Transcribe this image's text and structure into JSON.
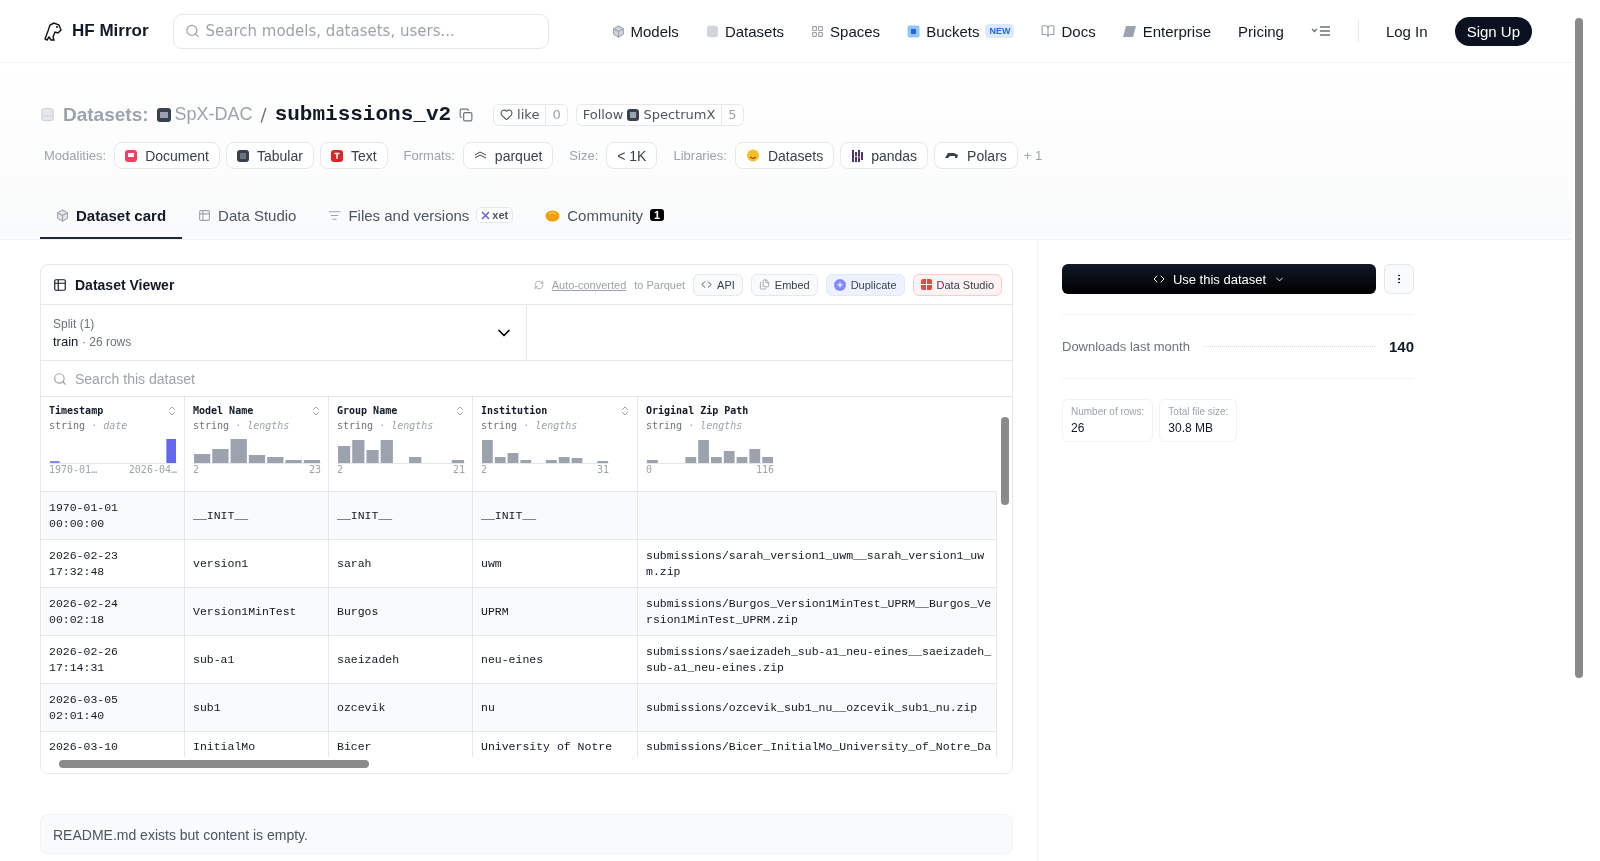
{
  "header": {
    "brand": "HF Mirror",
    "search": {
      "placeholder": "Search models, datasets, users..."
    },
    "nav": [
      {
        "label": "Models",
        "kind": "models"
      },
      {
        "label": "Datasets",
        "kind": "datasets"
      },
      {
        "label": "Spaces",
        "kind": "spaces"
      },
      {
        "label": "Buckets",
        "kind": "buckets",
        "badge": "NEW"
      },
      {
        "label": "Docs",
        "kind": "docs"
      },
      {
        "label": "Enterprise",
        "kind": "enterprise"
      },
      {
        "label": "Pricing",
        "kind": "plain"
      }
    ],
    "login": "Log In",
    "signup": "Sign Up"
  },
  "repo": {
    "type": "Datasets:",
    "owner": "SpX-DAC",
    "separator": "/",
    "name": "submissions_v2",
    "like": {
      "label": "like",
      "count": "0"
    },
    "follow": {
      "label": "Follow",
      "org": "SpectrumX",
      "count": "5"
    }
  },
  "tags": [
    {
      "label": "Modalities:",
      "items": [
        {
          "text": "Document",
          "kind": "document"
        },
        {
          "text": "Tabular",
          "kind": "tabular"
        },
        {
          "text": "Text",
          "kind": "text"
        }
      ]
    },
    {
      "label": "Formats:",
      "items": [
        {
          "text": "parquet",
          "kind": "parquet"
        }
      ]
    },
    {
      "label": "Size:",
      "items": [
        {
          "text": "< 1K",
          "kind": "plain"
        }
      ]
    },
    {
      "label": "Libraries:",
      "items": [
        {
          "text": "Datasets",
          "kind": "hf"
        },
        {
          "text": "pandas",
          "kind": "pandas"
        },
        {
          "text": "Polars",
          "kind": "polars"
        }
      ],
      "more": "+ 1"
    }
  ],
  "tabs": [
    {
      "label": "Dataset card",
      "kind": "card",
      "selected": true
    },
    {
      "label": "Data Studio",
      "kind": "studio",
      "selected": false
    },
    {
      "label": "Files and versions",
      "kind": "files",
      "badge": "xet",
      "selected": false
    },
    {
      "label": "Community",
      "kind": "community",
      "count": "1",
      "selected": false
    }
  ],
  "viewer": {
    "title": "Dataset Viewer",
    "converted_link": "Auto-converted",
    "converted_rest": "to Parquet",
    "actions": [
      {
        "label": "API",
        "kind": "api"
      },
      {
        "label": "Embed",
        "kind": "embed"
      },
      {
        "label": "Duplicate",
        "kind": "duplicate"
      },
      {
        "label": "Data Studio",
        "kind": "studio"
      }
    ],
    "split": {
      "label": "Split (1)",
      "name": "train",
      "dot": "·",
      "rows": "26 rows"
    },
    "search": {
      "placeholder": "Search this dataset"
    },
    "columns": [
      {
        "name": "Timestamp",
        "type": "string",
        "dot": "·",
        "stat": "date",
        "min": "1970-01…",
        "max": "2026-04…"
      },
      {
        "name": "Model Name",
        "type": "string",
        "dot": "·",
        "stat": "lengths",
        "min": "2",
        "max": "23"
      },
      {
        "name": "Group Name",
        "type": "string",
        "dot": "·",
        "stat": "lengths",
        "min": "2",
        "max": "21"
      },
      {
        "name": "Institution",
        "type": "string",
        "dot": "·",
        "stat": "lengths",
        "min": "2",
        "max": "31"
      },
      {
        "name": "Original Zip Path",
        "type": "string",
        "dot": "·",
        "stat": "lengths",
        "min": "0",
        "max": "116"
      }
    ],
    "rows": [
      [
        "1970-01-01 00:00:00",
        "__INIT__",
        "__INIT__",
        "__INIT__",
        ""
      ],
      [
        "2026-02-23 17:32:48",
        "version1",
        "sarah",
        "uwm",
        "submissions/sarah_version1_uwm__sarah_version1_uwm.zip"
      ],
      [
        "2026-02-24 00:02:18",
        "Version1MinTest",
        "Burgos",
        "UPRM",
        "submissions/Burgos_Version1MinTest_UPRM__Burgos_Version1MinTest_UPRM.zip"
      ],
      [
        "2026-02-26 17:14:31",
        "sub-a1",
        "saeizadeh",
        "neu-eines",
        "submissions/saeizadeh_sub-a1_neu-eines__saeizadeh_sub-a1_neu-eines.zip"
      ],
      [
        "2026-03-05 02:01:40",
        "sub1",
        "ozcevik",
        "nu",
        "submissions/ozcevik_sub1_nu__ozcevik_sub1_nu.zip"
      ],
      [
        "2026-03-10",
        "InitialMo",
        "Bicer",
        "University of Notre",
        "submissions/Bicer_InitialMo_University_of_Notre_Da"
      ]
    ]
  },
  "readme": "README.md exists but content is empty.",
  "sidebar": {
    "use_button": "Use this dataset",
    "downloads_label": "Downloads last month",
    "downloads": "140",
    "stats": [
      {
        "label": "Number of rows:",
        "value": "26"
      },
      {
        "label": "Total file size:",
        "value": "30.8 MB"
      }
    ]
  }
}
